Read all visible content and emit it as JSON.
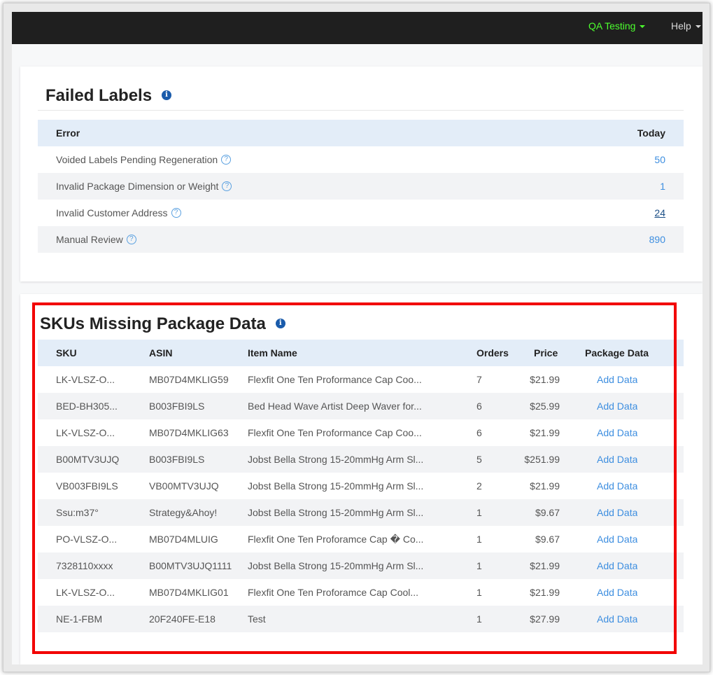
{
  "nav": {
    "account_label": "QA Testing",
    "help_label": "Help",
    "account_color": "#4cff2e"
  },
  "failed_labels": {
    "title": "Failed Labels",
    "headers": {
      "error": "Error",
      "today": "Today"
    },
    "rows": [
      {
        "label": "Voided Labels Pending Regeneration",
        "value": "50"
      },
      {
        "label": "Invalid Package Dimension or Weight",
        "value": "1"
      },
      {
        "label": "Invalid Customer Address",
        "value": "24"
      },
      {
        "label": "Manual Review",
        "value": "890"
      }
    ]
  },
  "skus_missing": {
    "title": "SKUs Missing Package Data",
    "headers": {
      "sku": "SKU",
      "asin": "ASIN",
      "item_name": "Item Name",
      "orders": "Orders",
      "price": "Price",
      "package_data": "Package Data"
    },
    "rows": [
      {
        "sku": "LK-VLSZ-O...",
        "asin": "MB07D4MKLIG59",
        "item_name": "Flexfit One Ten Proformance Cap Coo...",
        "orders": "7",
        "price": "$21.99",
        "action": "Add Data"
      },
      {
        "sku": "BED-BH305...",
        "asin": "B003FBI9LS",
        "item_name": "Bed Head Wave Artist Deep Waver for...",
        "orders": "6",
        "price": "$25.99",
        "action": "Add Data"
      },
      {
        "sku": "LK-VLSZ-O...",
        "asin": "MB07D4MKLIG63",
        "item_name": "Flexfit One Ten Proformance Cap Coo...",
        "orders": "6",
        "price": "$21.99",
        "action": "Add Data"
      },
      {
        "sku": "B00MTV3UJQ",
        "asin": "B003FBI9LS",
        "item_name": "Jobst Bella Strong 15-20mmHg Arm Sl...",
        "orders": "5",
        "price": "$251.99",
        "action": "Add Data"
      },
      {
        "sku": "VB003FBI9LS",
        "asin": "VB00MTV3UJQ",
        "item_name": "Jobst Bella Strong 15-20mmHg Arm Sl...",
        "orders": "2",
        "price": "$21.99",
        "action": "Add Data"
      },
      {
        "sku": "Ssu:m37°",
        "asin": "Strategy&Ahoy!",
        "item_name": "Jobst Bella Strong 15-20mmHg Arm Sl...",
        "orders": "1",
        "price": "$9.67",
        "action": "Add Data"
      },
      {
        "sku": "PO-VLSZ-O...",
        "asin": "MB07D4MLUIG",
        "item_name": "Flexfit One Ten Proforamce Cap � Co...",
        "orders": "1",
        "price": "$9.67",
        "action": "Add Data"
      },
      {
        "sku": "7328110xxxx",
        "asin": "B00MTV3UJQ1111",
        "item_name": "Jobst Bella Strong 15-20mmHg Arm Sl...",
        "orders": "1",
        "price": "$21.99",
        "action": "Add Data"
      },
      {
        "sku": "LK-VLSZ-O...",
        "asin": "MB07D4MKLIG01",
        "item_name": "Flexfit One Ten Proforamce Cap Cool...",
        "orders": "1",
        "price": "$21.99",
        "action": "Add Data"
      },
      {
        "sku": "NE-1-FBM",
        "asin": "20F240FE-E18",
        "item_name": "Test",
        "orders": "1",
        "price": "$27.99",
        "action": "Add Data"
      }
    ]
  },
  "colors": {
    "navbar": "#1f1f1f",
    "header_row": "#e3edf8",
    "link": "#3d8ee0",
    "highlight_border": "#f20000"
  }
}
